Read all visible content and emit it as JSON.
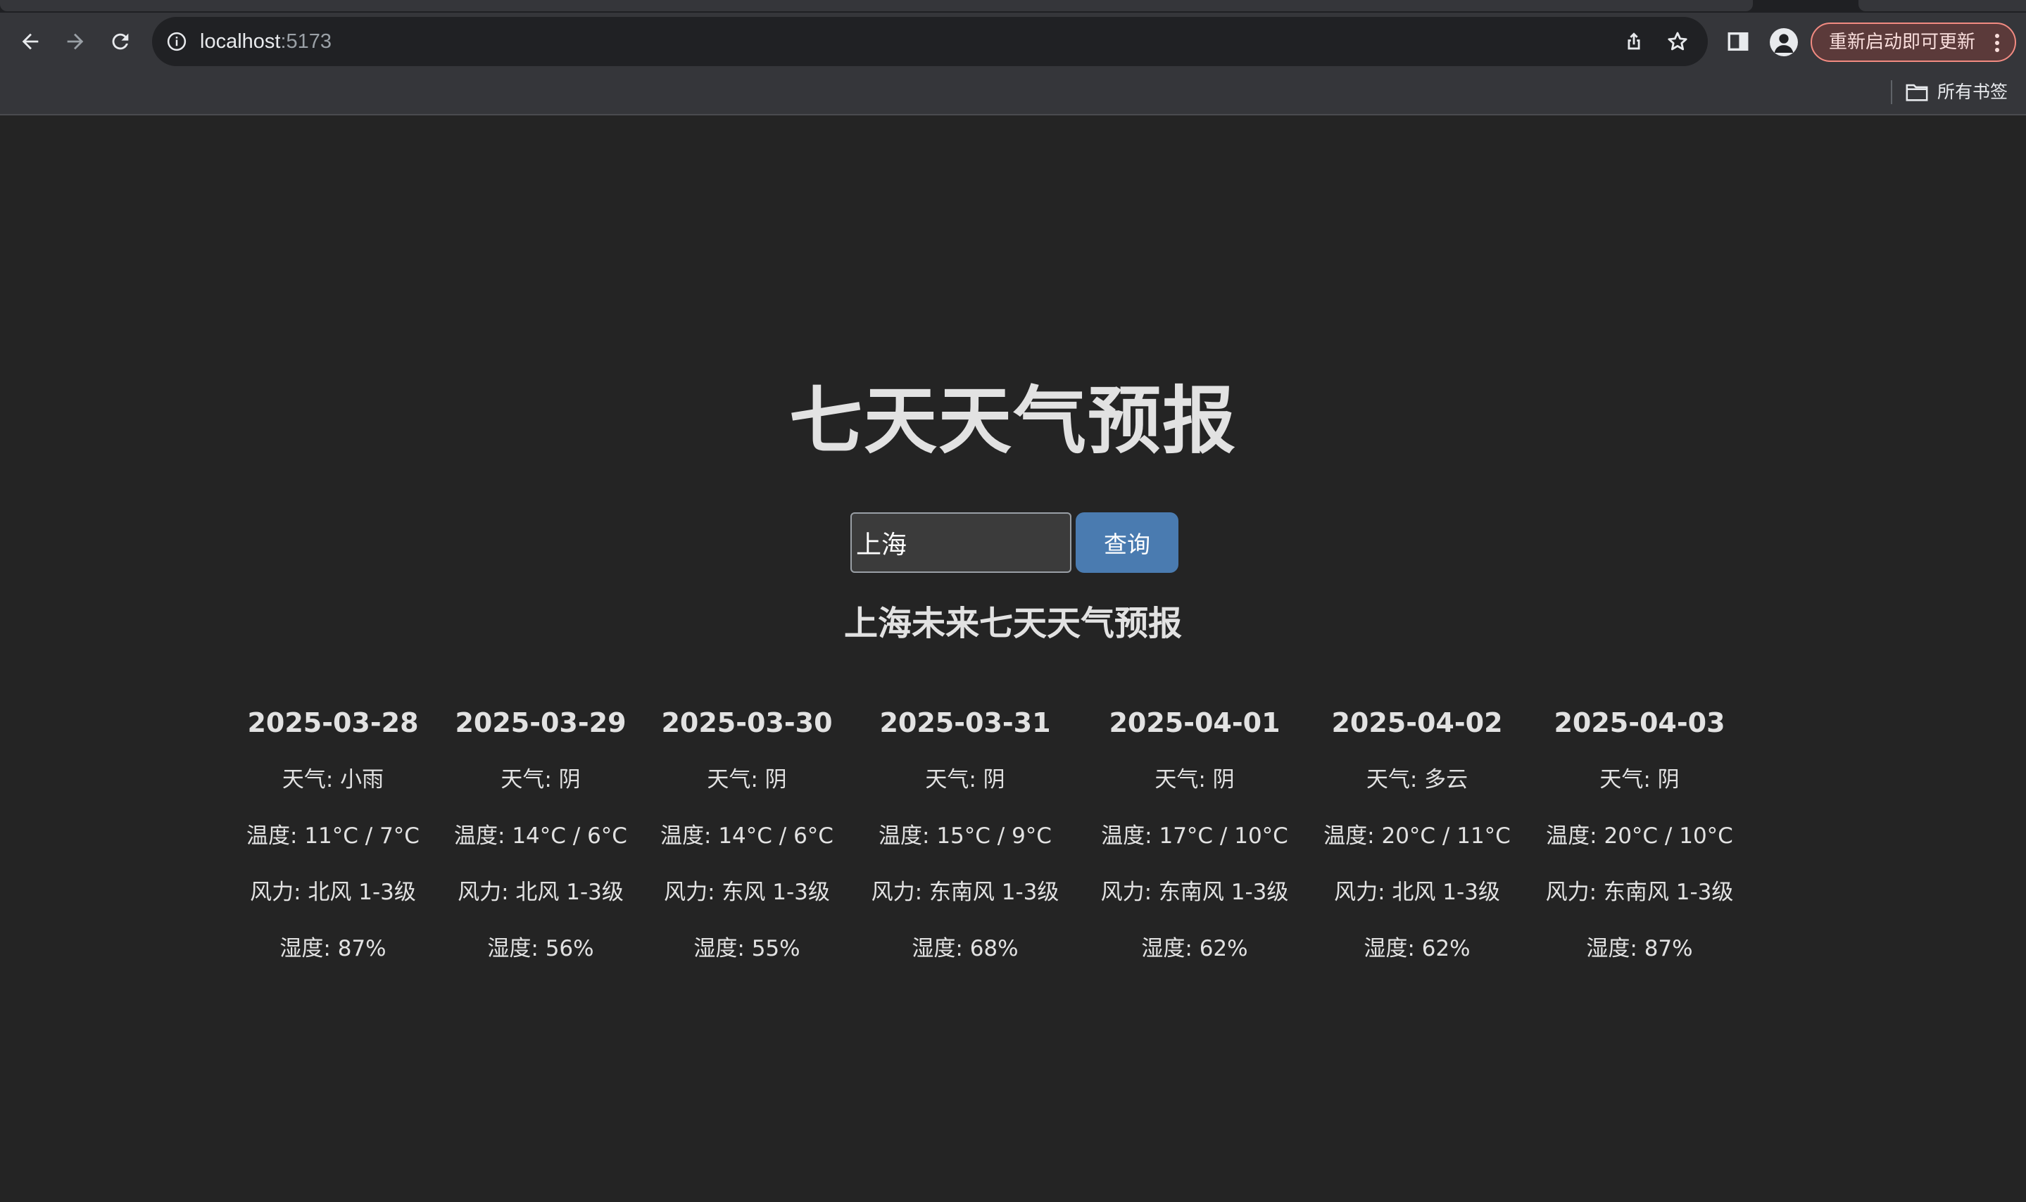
{
  "browser": {
    "url_host": "localhost",
    "url_port": ":5173",
    "update_button": "重新启动即可更新",
    "bookmarks_all": "所有书签"
  },
  "app": {
    "title": "七天天气预报",
    "search": {
      "value": "上海",
      "button": "查询"
    },
    "forecast_heading": "上海未来七天天气预报",
    "days": [
      {
        "date": "2025-03-28",
        "weather": "天气: 小雨",
        "temp": "温度: 11°C / 7°C",
        "wind": "风力: 北风 1-3级",
        "humidity": "湿度: 87%"
      },
      {
        "date": "2025-03-29",
        "weather": "天气: 阴",
        "temp": "温度: 14°C / 6°C",
        "wind": "风力: 北风 1-3级",
        "humidity": "湿度: 56%"
      },
      {
        "date": "2025-03-30",
        "weather": "天气: 阴",
        "temp": "温度: 14°C / 6°C",
        "wind": "风力: 东风 1-3级",
        "humidity": "湿度: 55%"
      },
      {
        "date": "2025-03-31",
        "weather": "天气: 阴",
        "temp": "温度: 15°C / 9°C",
        "wind": "风力: 东南风 1-3级",
        "humidity": "湿度: 68%"
      },
      {
        "date": "2025-04-01",
        "weather": "天气: 阴",
        "temp": "温度: 17°C / 10°C",
        "wind": "风力: 东南风 1-3级",
        "humidity": "湿度: 62%"
      },
      {
        "date": "2025-04-02",
        "weather": "天气: 多云",
        "temp": "温度: 20°C / 11°C",
        "wind": "风力: 北风 1-3级",
        "humidity": "湿度: 62%"
      },
      {
        "date": "2025-04-03",
        "weather": "天气: 阴",
        "temp": "温度: 20°C / 10°C",
        "wind": "风力: 东南风 1-3级",
        "humidity": "湿度: 87%"
      }
    ]
  },
  "colors": {
    "page_background": "#242424",
    "button_accent": "#4a7bb0",
    "update_pill": "#5b3a3a"
  }
}
